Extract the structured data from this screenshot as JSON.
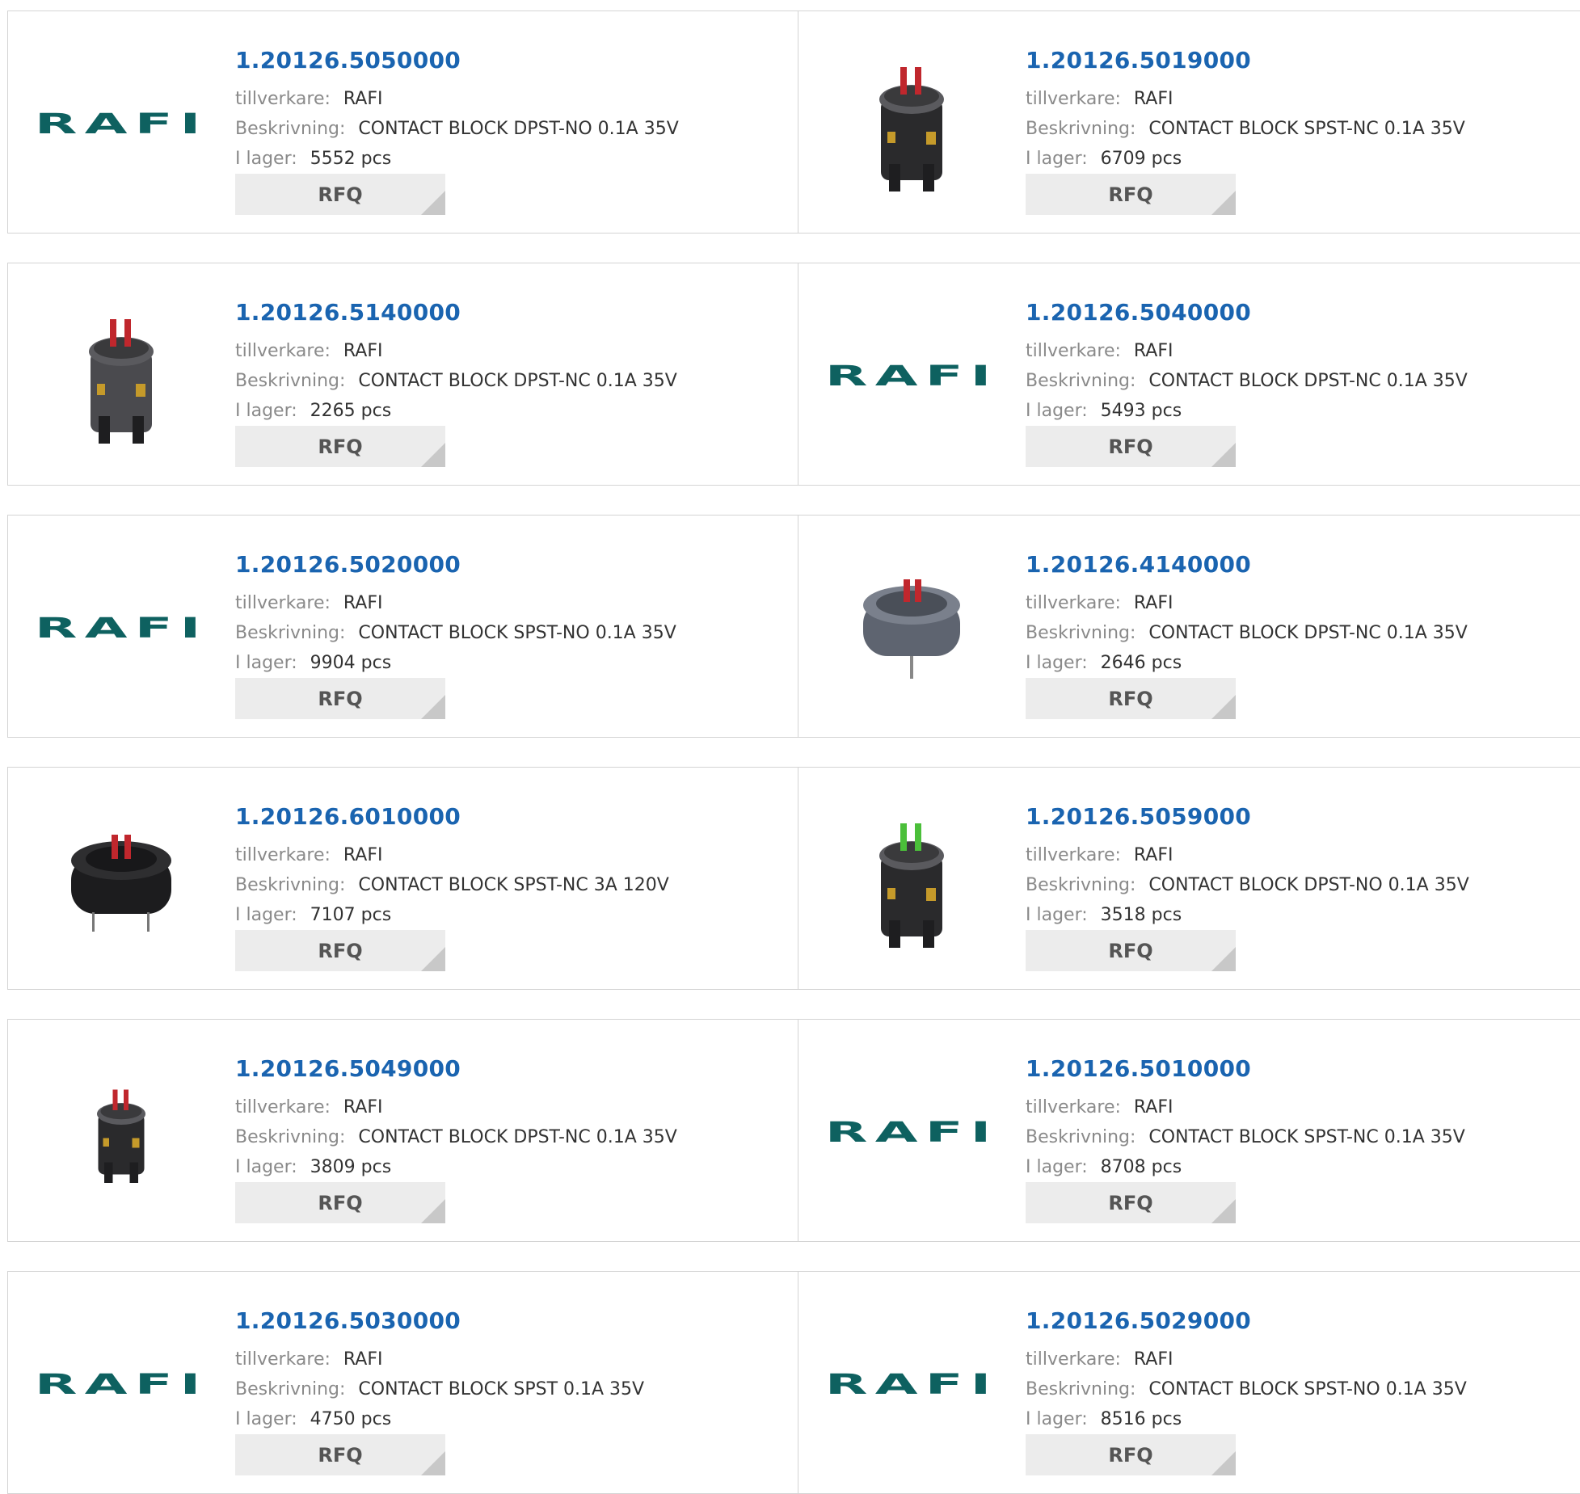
{
  "labels": {
    "manufacturer": "tillverkare:",
    "description": "Beskrivning:",
    "stock": "I lager:",
    "rfq": "RFQ"
  },
  "products": [
    {
      "pn": "1.20126.5050000",
      "manufacturer": "RAFI",
      "description": "CONTACT BLOCK DPST-NO 0.1A 35V",
      "stock": "5552 pcs",
      "thumb": "logo"
    },
    {
      "pn": "1.20126.5019000",
      "manufacturer": "RAFI",
      "description": "CONTACT BLOCK SPST-NC 0.1A 35V",
      "stock": "6709 pcs",
      "thumb": "tall-block"
    },
    {
      "pn": "1.20126.5140000",
      "manufacturer": "RAFI",
      "description": "CONTACT BLOCK DPST-NC 0.1A 35V",
      "stock": "2265 pcs",
      "thumb": "tall-grey-block"
    },
    {
      "pn": "1.20126.5040000",
      "manufacturer": "RAFI",
      "description": "CONTACT BLOCK DPST-NC 0.1A 35V",
      "stock": "5493 pcs",
      "thumb": "logo"
    },
    {
      "pn": "1.20126.5020000",
      "manufacturer": "RAFI",
      "description": "CONTACT BLOCK SPST-NO 0.1A 35V",
      "stock": "9904 pcs",
      "thumb": "logo"
    },
    {
      "pn": "1.20126.4140000",
      "manufacturer": "RAFI",
      "description": "CONTACT BLOCK DPST-NC 0.1A 35V",
      "stock": "2646 pcs",
      "thumb": "round-grey-block"
    },
    {
      "pn": "1.20126.6010000",
      "manufacturer": "RAFI",
      "description": "CONTACT BLOCK SPST-NC 3A 120V",
      "stock": "7107 pcs",
      "thumb": "round-black-block"
    },
    {
      "pn": "1.20126.5059000",
      "manufacturer": "RAFI",
      "description": "CONTACT BLOCK DPST-NO 0.1A 35V",
      "stock": "3518 pcs",
      "thumb": "tall-green-block"
    },
    {
      "pn": "1.20126.5049000",
      "manufacturer": "RAFI",
      "description": "CONTACT BLOCK DPST-NC 0.1A 35V",
      "stock": "3809 pcs",
      "thumb": "small-block"
    },
    {
      "pn": "1.20126.5010000",
      "manufacturer": "RAFI",
      "description": "CONTACT BLOCK SPST-NC 0.1A 35V",
      "stock": "8708 pcs",
      "thumb": "logo"
    },
    {
      "pn": "1.20126.5030000",
      "manufacturer": "RAFI",
      "description": "CONTACT BLOCK SPST 0.1A 35V",
      "stock": "4750 pcs",
      "thumb": "logo"
    },
    {
      "pn": "1.20126.5029000",
      "manufacturer": "RAFI",
      "description": "CONTACT BLOCK SPST-NO 0.1A 35V",
      "stock": "8516 pcs",
      "thumb": "logo"
    }
  ],
  "logo_text": "RAFI",
  "colors": {
    "part_number": "#1a64b0",
    "logo": "#0e6160",
    "rfq_bg": "#ececec",
    "border": "#d4d4d4"
  }
}
